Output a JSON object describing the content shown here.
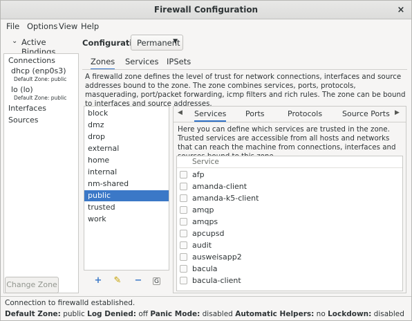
{
  "window": {
    "title": "Firewall Configuration",
    "close_glyph": "×"
  },
  "menu": {
    "file": "File",
    "options": "Options",
    "view": "View",
    "help": "Help"
  },
  "sidebar": {
    "header": "Active Bindings",
    "connections_label": "Connections",
    "connections": [
      {
        "name": "dhcp (enp0s3)",
        "zone": "Default Zone: public"
      },
      {
        "name": "lo (lo)",
        "zone": "Default Zone: public"
      }
    ],
    "interfaces_label": "Interfaces",
    "sources_label": "Sources",
    "change_zone": "Change Zone"
  },
  "configuration": {
    "label": "Configuration:",
    "value": "Permanent"
  },
  "main_tabs": [
    "Zones",
    "Services",
    "IPSets"
  ],
  "zones_description": "A firewalld zone defines the level of trust for network connections, interfaces and source addresses bound to the zone. The zone combines services, ports, protocols, masquerading, port/packet forwarding, icmp filters and rich rules. The zone can be bound to interfaces and source addresses.",
  "zones": [
    "block",
    "dmz",
    "drop",
    "external",
    "home",
    "internal",
    "nm-shared",
    "public",
    "trusted",
    "work"
  ],
  "selected_zone": "public",
  "zone_subtabs": [
    "Services",
    "Ports",
    "Protocols",
    "Source Ports"
  ],
  "services_description": "Here you can define which services are trusted in the zone. Trusted services are accessible from all hosts and networks that can reach the machine from connections, interfaces and sources bound to this zone.",
  "services_table": {
    "header": "Service",
    "rows": [
      "afp",
      "amanda-client",
      "amanda-k5-client",
      "amqp",
      "amqps",
      "apcupsd",
      "audit",
      "ausweisapp2",
      "bacula",
      "bacula-client"
    ]
  },
  "status": {
    "connection": "Connection to firewalld established.",
    "default_zone_label": "Default Zone:",
    "default_zone": "public",
    "log_denied_label": "Log Denied:",
    "log_denied": "off",
    "panic_label": "Panic Mode:",
    "panic": "disabled",
    "helpers_label": "Automatic Helpers:",
    "helpers": "no",
    "lockdown_label": "Lockdown:",
    "lockdown": "disabled"
  },
  "colors": {
    "accent": "#3b78c7",
    "window_bg": "#f6f5f4"
  }
}
